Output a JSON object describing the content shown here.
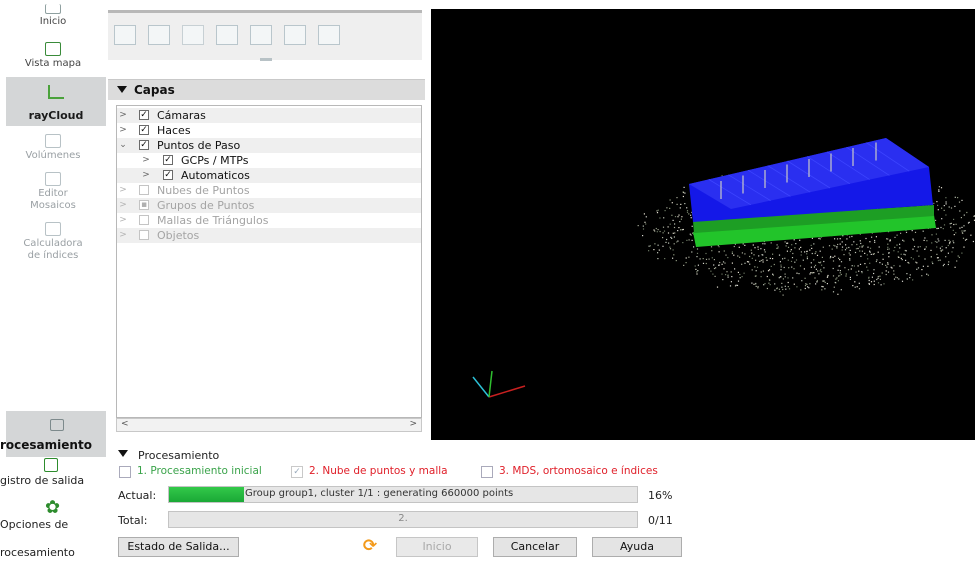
{
  "nav": {
    "items": [
      {
        "key": "inicio",
        "label": "Inicio",
        "icon": "home-icon"
      },
      {
        "key": "vista-mapa",
        "label": "Vista mapa",
        "icon": "map-icon"
      },
      {
        "key": "raycloud",
        "label": "rayCloud",
        "icon": "raycloud-icon"
      },
      {
        "key": "volumenes",
        "label": "Volúmenes",
        "icon": "volume-icon"
      },
      {
        "key": "editor-mosaicos",
        "label": "Editor\nMosaicos",
        "icon": "mosaic-editor-icon"
      },
      {
        "key": "calculadora",
        "label": "Calculadora\nde índices",
        "icon": "index-calculator-icon"
      }
    ],
    "procesamiento_label": "rocesamiento",
    "registro_label": "gistro de salida",
    "opciones_label": "Opciones de",
    "opciones_label2": "rocesamiento"
  },
  "layers": {
    "title": "Capas",
    "rows": [
      {
        "label": "Cámaras",
        "checked": true,
        "expanded": false,
        "level": 0,
        "dim": false
      },
      {
        "label": "Haces",
        "checked": true,
        "expanded": false,
        "level": 0,
        "dim": false
      },
      {
        "label": "Puntos de Paso",
        "checked": true,
        "expanded": true,
        "level": 0,
        "dim": false
      },
      {
        "label": "GCPs / MTPs",
        "checked": true,
        "expanded": false,
        "level": 1,
        "dim": false
      },
      {
        "label": "Automaticos",
        "checked": true,
        "expanded": false,
        "level": 1,
        "dim": false
      },
      {
        "label": "Nubes de Puntos",
        "checked": false,
        "expanded": false,
        "level": 0,
        "dim": true
      },
      {
        "label": "Grupos de Puntos",
        "checked": false,
        "expanded": false,
        "level": 0,
        "dim": true
      },
      {
        "label": "Mallas de Triángulos",
        "checked": false,
        "expanded": false,
        "level": 0,
        "dim": true
      },
      {
        "label": "Objetos",
        "checked": false,
        "expanded": false,
        "level": 0,
        "dim": true
      }
    ]
  },
  "processing": {
    "title": "Procesamiento",
    "steps": [
      {
        "label": "1. Procesamiento inicial",
        "color": "#3aa34a",
        "checked": false
      },
      {
        "label": "2. Nube de puntos y malla",
        "color": "#e0202a",
        "checked": true
      },
      {
        "label": "3. MDS, ortomosaico e índices",
        "color": "#e0202a",
        "checked": false
      }
    ],
    "actual_label": "Actual:",
    "actual_text": "Group group1, cluster 1/1 : generating 660000 points",
    "actual_progress": 0.16,
    "actual_pct": "16%",
    "total_label": "Total:",
    "total_text": "2.",
    "total_progress": 0.0,
    "total_count": "0/11",
    "buttons": {
      "estado": "Estado de Salida...",
      "inicio": "Inicio",
      "cancelar": "Cancelar",
      "ayuda": "Ayuda"
    }
  },
  "colors": {
    "model_top": "#1418e8",
    "model_base": "#22c42a",
    "progress_fill": "#1aa836",
    "refresh_icon": "#f39a1b"
  }
}
